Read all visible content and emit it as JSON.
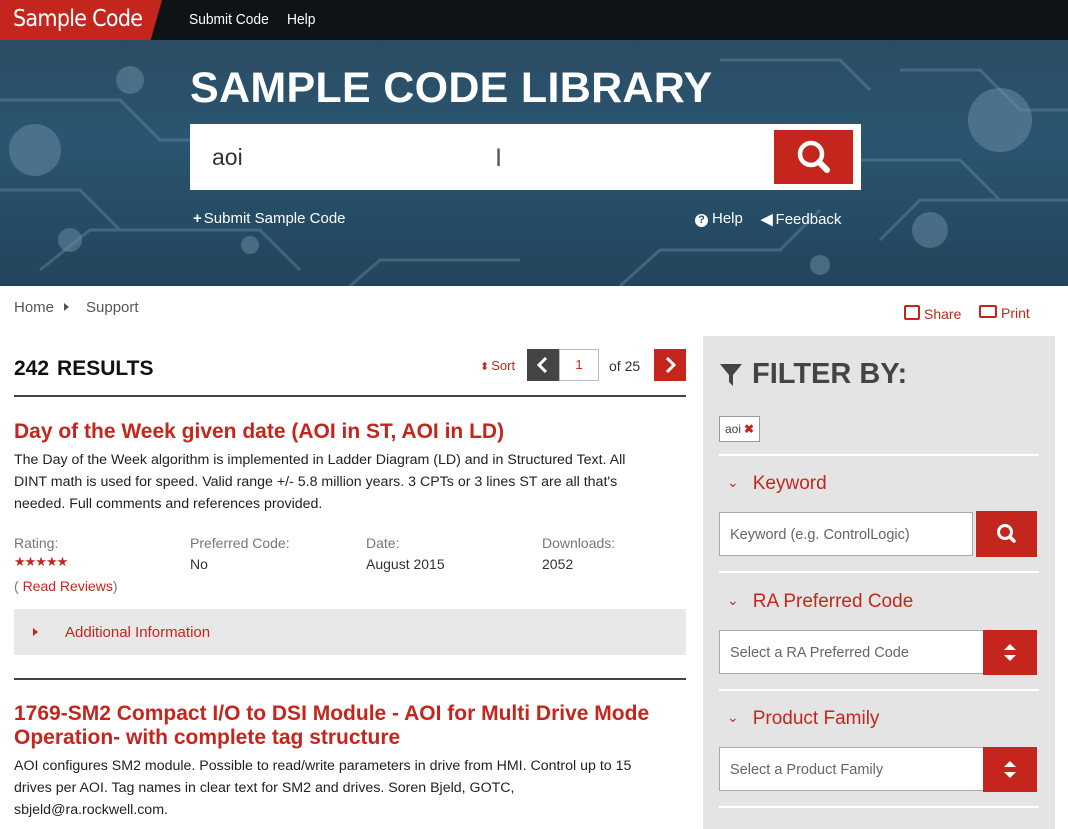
{
  "brand": "Sample Code",
  "nav": {
    "submit": "Submit Code",
    "help": "Help"
  },
  "hero": {
    "title": "SAMPLE CODE LIBRARY",
    "search_value": "aoi",
    "submit_link": "Submit Sample Code",
    "help_link": "Help",
    "feedback_link": "Feedback"
  },
  "breadcrumb": {
    "home": "Home",
    "support": "Support"
  },
  "utility": {
    "share": "Share",
    "print": "Print"
  },
  "results": {
    "count": "242",
    "label": "RESULTS",
    "sort": "Sort",
    "page": "1",
    "of_pages": "of 25"
  },
  "items": [
    {
      "title": "Day of the Week given date (AOI in ST, AOI in LD)",
      "desc_lines": [
        "The Day of the Week algorithm is implemented in Ladder Diagram (LD) and in Structured Text. All",
        "DINT math is used for speed. Valid range +/- 5.8 million years. 3 CPTs or 3 lines ST are all that's",
        "needed. Full comments and references provided."
      ],
      "rating_label": "Rating:",
      "rating_stars": "★★★★★",
      "read_reviews": "Read Reviews",
      "preferred_label": "Preferred Code:",
      "preferred_value": "No",
      "date_label": "Date:",
      "date_value": "August 2015",
      "downloads_label": "Downloads:",
      "downloads_value": "2052",
      "additional": "Additional Information"
    },
    {
      "title_lines": [
        "1769-SM2 Compact I/O to DSI Module - AOI for Multi Drive Mode",
        "Operation- with complete tag structure"
      ],
      "desc_lines": [
        "AOI configures SM2 module. Possible to read/write parameters in drive from HMI. Control up to 15",
        "drives per AOI. Tag names in clear text for SM2 and drives. Soren Bjeld, GOTC,",
        "sbjeld@ra.rockwell.com."
      ]
    }
  ],
  "filter": {
    "title": "FILTER BY:",
    "chip": "aoi",
    "keyword_heading": "Keyword",
    "keyword_placeholder": "Keyword (e.g. ControlLogic)",
    "preferred_heading": "RA Preferred Code",
    "preferred_placeholder": "Select a RA Preferred Code",
    "family_heading": "Product Family",
    "family_placeholder": "Select a Product Family"
  }
}
